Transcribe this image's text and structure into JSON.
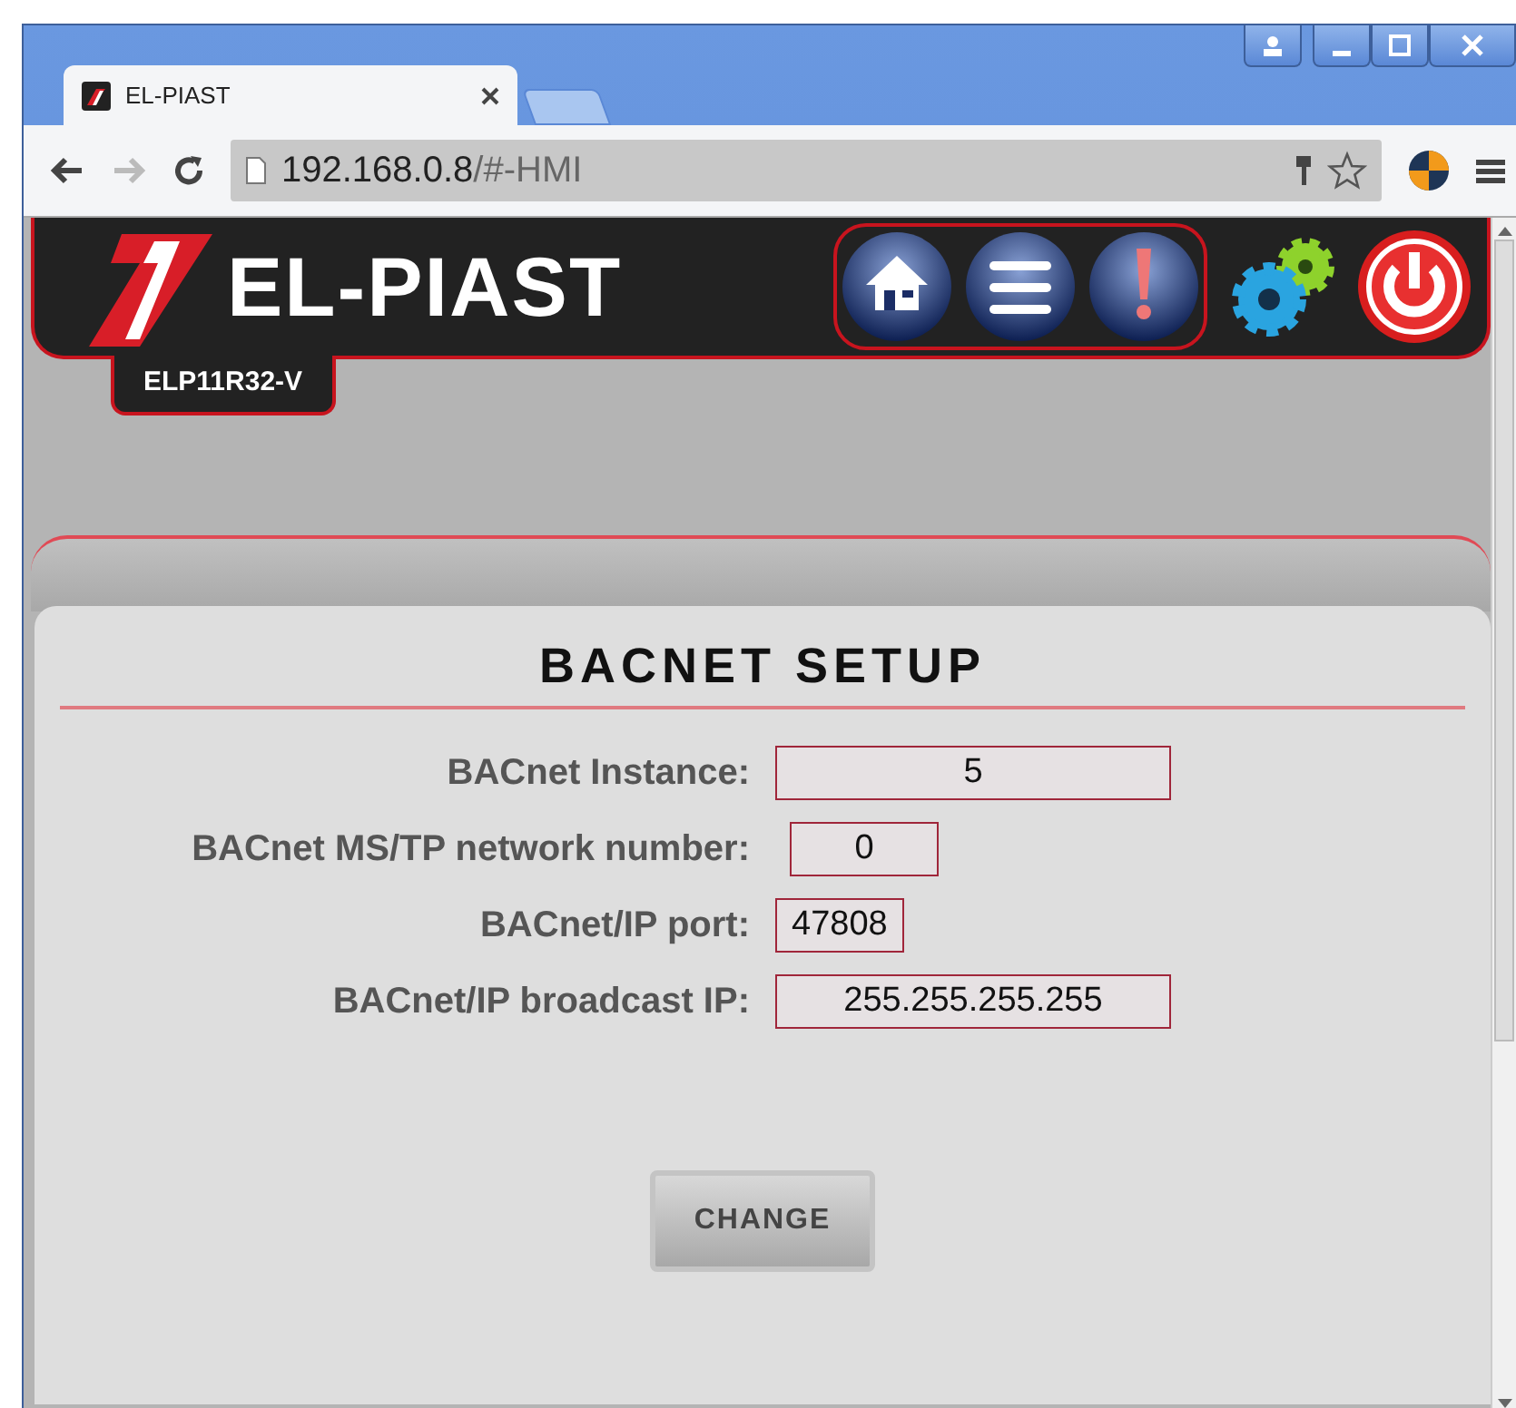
{
  "browser": {
    "tab_title": "EL-PIAST",
    "address_host": "192.168.0.8",
    "address_path": "/#-HMI"
  },
  "header": {
    "brand": "EL-PIAST",
    "model": "ELP11R32-V"
  },
  "panel": {
    "title": "BACNET SETUP",
    "fields": [
      {
        "label": "BACnet Instance:",
        "value": "5"
      },
      {
        "label": "BACnet MS/TP network number:",
        "value": "0"
      },
      {
        "label": "BACnet/IP port:",
        "value": "47808"
      },
      {
        "label": "BACnet/IP broadcast IP:",
        "value": "255.255.255.255"
      }
    ],
    "button": "CHANGE"
  }
}
